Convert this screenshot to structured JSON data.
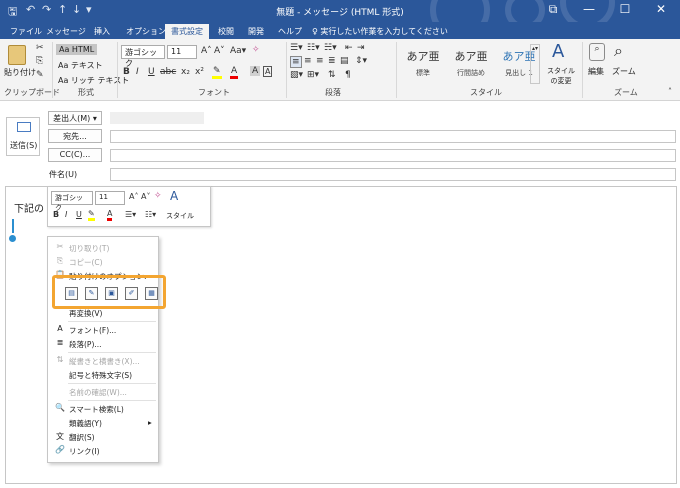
{
  "window": {
    "title": "無題 - メッセージ (HTML 形式)",
    "controls": [
      "⧉",
      "—",
      "☐",
      "✕"
    ]
  },
  "qat": [
    "🖫",
    "↶",
    "↷",
    "↑",
    "↓",
    "▾"
  ],
  "tabs": [
    "ファイル",
    "メッセージ",
    "挿入",
    "オプション",
    "書式設定",
    "校閲",
    "開発",
    "ヘルプ"
  ],
  "tell_me": "実行したい作業を入力してください",
  "ribbon": {
    "clipboard": {
      "paste_label": "貼り付け",
      "group_label": "クリップボード"
    },
    "format": {
      "html": "Aa HTML",
      "text": "Aa テキスト",
      "rich": "Aa リッチ テキスト",
      "group_label": "形式"
    },
    "font": {
      "name": "游ゴシック",
      "size": "11",
      "group_label": "フォント"
    },
    "paragraph": {
      "group_label": "段落"
    },
    "styles": {
      "items": [
        {
          "sample": "あア亜",
          "name": "標準"
        },
        {
          "sample": "あア亜",
          "name": "行間詰め"
        },
        {
          "sample": "あア亜",
          "name": "見出し 1"
        }
      ],
      "change_label": "スタイルの変更",
      "group_label": "スタイル"
    },
    "edit": {
      "label": "編集"
    },
    "zoom": {
      "label": "ズーム",
      "group_label": "ズーム"
    }
  },
  "header": {
    "from_label": "差出人(M)",
    "send_label": "送信(S)",
    "to_label": "宛先...",
    "cc_label": "CC(C)...",
    "subject_label": "件名(U)"
  },
  "body": {
    "text": "下記の"
  },
  "mini_toolbar": {
    "font": "游ゴシック",
    "size": "11",
    "styles_label": "スタイル"
  },
  "context_menu": {
    "items": [
      {
        "icon": "✂",
        "label": "切り取り(T)",
        "disabled": true
      },
      {
        "icon": "⎘",
        "label": "コピー(C)",
        "disabled": true
      },
      {
        "icon": "📋",
        "label": "貼り付けのオプション:",
        "disabled": false
      },
      {
        "icon": "",
        "label": "再変換(V)",
        "disabled": false
      },
      {
        "icon": "A",
        "label": "フォント(F)...",
        "disabled": false
      },
      {
        "icon": "≣",
        "label": "段落(P)...",
        "disabled": false
      },
      {
        "icon": "⇅",
        "label": "縦書きと横書き(X)...",
        "disabled": true
      },
      {
        "icon": "",
        "label": "記号と特殊文字(S)",
        "disabled": false
      },
      {
        "icon": "",
        "label": "名前の確認(W)...",
        "disabled": true
      },
      {
        "icon": "🔍",
        "label": "スマート検索(L)",
        "disabled": false
      },
      {
        "icon": "",
        "label": "類義語(Y)",
        "disabled": false
      },
      {
        "icon": "文",
        "label": "翻訳(S)",
        "disabled": false
      },
      {
        "icon": "🔗",
        "label": "リンク(I)",
        "disabled": false
      }
    ]
  },
  "colors": {
    "titlebar": "#2b579a",
    "highlight": "#f3a531"
  }
}
